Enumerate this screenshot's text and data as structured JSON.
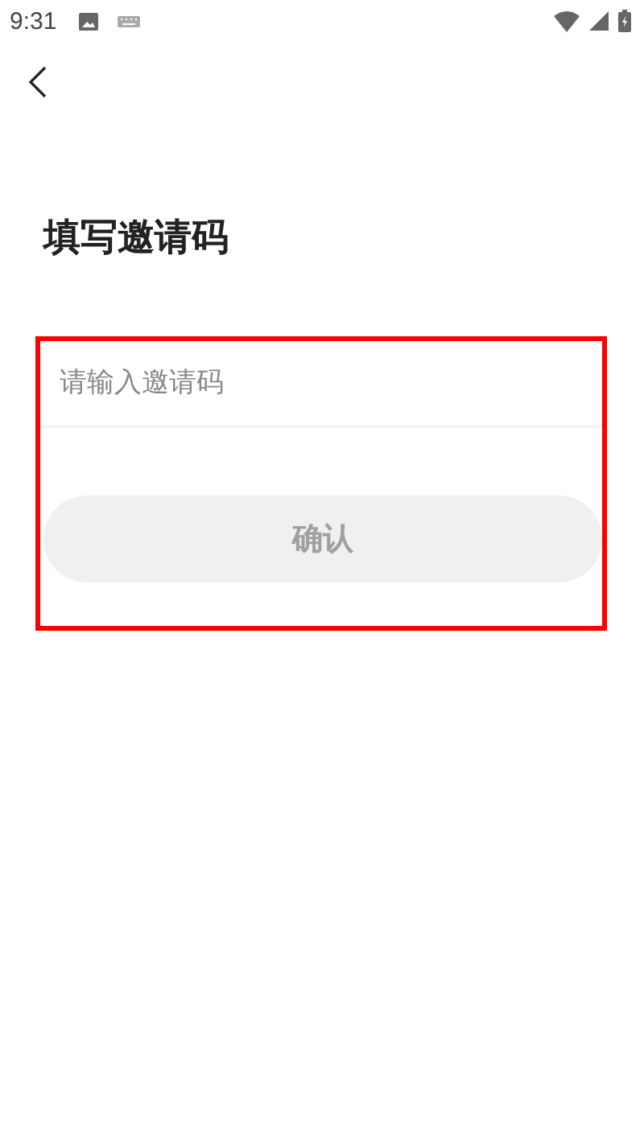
{
  "status_bar": {
    "time": "9:31"
  },
  "title": "填写邀请码",
  "invite_field": {
    "placeholder": "请输入邀请码"
  },
  "confirm_button": {
    "label": "确认",
    "disabled": true
  },
  "highlight_frame": {
    "shown": true
  }
}
